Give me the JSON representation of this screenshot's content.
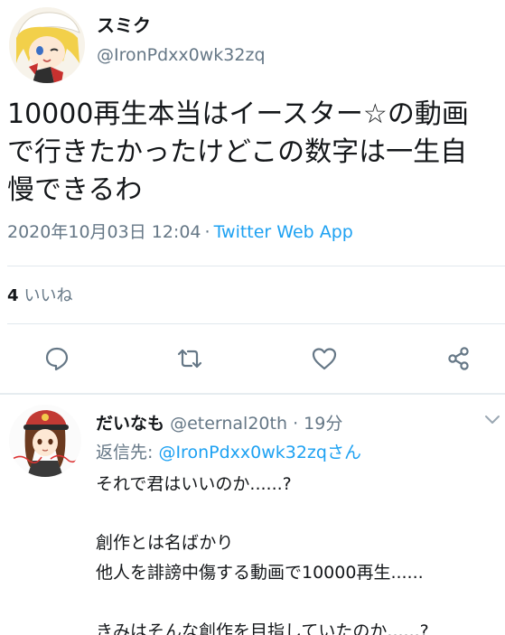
{
  "tweet": {
    "display_name": "スミク",
    "handle": "@IronPdxx0wk32zq",
    "text_lines": [
      "10000再生本当はイースター☆の動画",
      "で行きたかったけどこの数字は一生自",
      "慢できるわ"
    ],
    "timestamp": "2020年10月03日 12:04",
    "separator": "·",
    "source_app": "Twitter Web App",
    "likes_count": "4",
    "likes_label": "いいね",
    "avatar_icon": "anime-character-avatar"
  },
  "actions": {
    "reply_icon": "reply-icon",
    "retweet_icon": "retweet-icon",
    "like_icon": "heart-icon",
    "share_icon": "share-icon"
  },
  "reply": {
    "display_name": "だいなも",
    "handle": "@eternal20th",
    "separator": "·",
    "time": "19分",
    "reply_to_prefix": "返信先:",
    "reply_to_mention": "@IronPdxx0wk32zqさん",
    "body_lines": [
      "それで君はいいのか......?",
      "",
      "創作とは名ばかり",
      "他人を誹謗中傷する動画で10000再生......",
      "",
      "きみはそんな創作を目指していたのか......?"
    ],
    "avatar_icon": "anime-character-avatar"
  },
  "colors": {
    "text": "#14171a",
    "secondary": "#657786",
    "link": "#1da1f2",
    "divider": "#e1e8ed"
  }
}
